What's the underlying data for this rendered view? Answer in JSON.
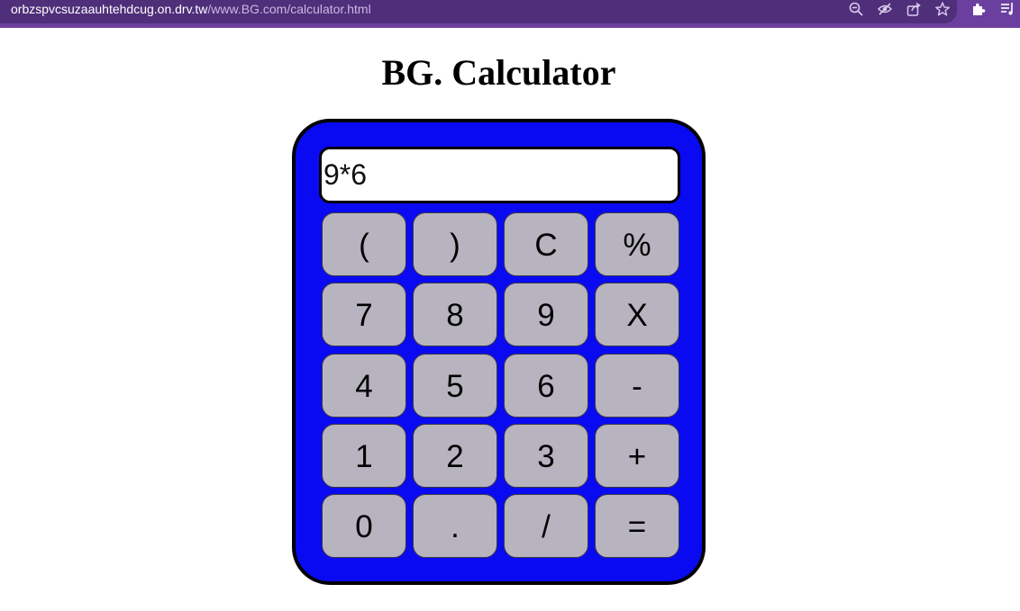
{
  "browser": {
    "url_host": "orbzspvcsuzaauhtehdcug.on.drv.tw",
    "url_path": "/www.BG.com/calculator.html"
  },
  "page": {
    "title": "BG. Calculator"
  },
  "calculator": {
    "display_value": "9*6",
    "keys": [
      "(",
      ")",
      "C",
      "%",
      "7",
      "8",
      "9",
      "X",
      "4",
      "5",
      "6",
      "-",
      "1",
      "2",
      "3",
      "+",
      "0",
      ".",
      "/",
      "="
    ]
  },
  "colors": {
    "browser_bar": "#6b3fa0",
    "calculator_body": "#0a0af2",
    "key_face": "#b7b3bf"
  }
}
